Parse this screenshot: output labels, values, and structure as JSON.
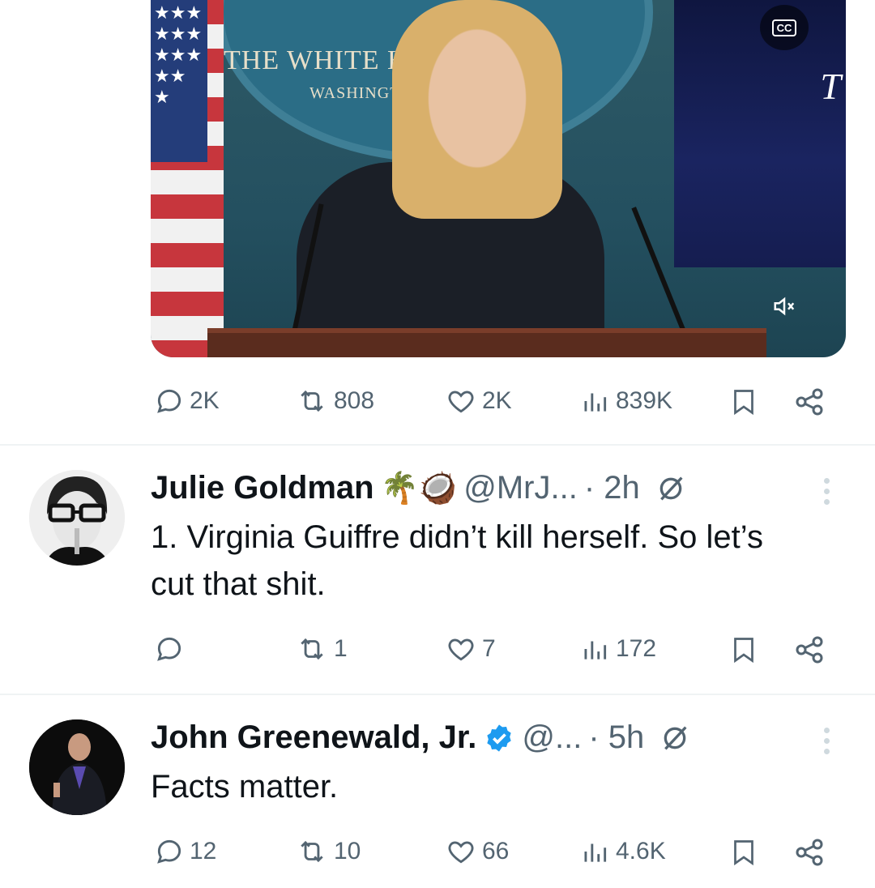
{
  "video": {
    "seal_line1": "THE WHITE HOUSE",
    "seal_line2": "WASHINGTON",
    "screen_letter": "T",
    "cc_label": "CC",
    "mute_icon": "speaker-muted-icon"
  },
  "main_post_actions": {
    "replies": "2K",
    "reposts": "808",
    "likes": "2K",
    "views": "839K"
  },
  "tweets": [
    {
      "name": "Julie Goldman",
      "emoji": "🌴🥥",
      "handle": "@MrJ...",
      "time": "· 2h",
      "text": "1. Virginia Guiffre didn’t kill herself.  So let’s cut that shit.",
      "replies": "",
      "reposts": "1",
      "likes": "7",
      "views": "172"
    },
    {
      "name": "John Greenewald, Jr.",
      "verified": true,
      "handle": "@...",
      "time": "· 5h",
      "text": "Facts matter.",
      "replies": "12",
      "reposts": "10",
      "likes": "66",
      "views": "4.6K"
    }
  ],
  "colors": {
    "text": "#0f1419",
    "secondary": "#536471",
    "verified": "#1d9bf0",
    "divider": "#eff3f4"
  }
}
